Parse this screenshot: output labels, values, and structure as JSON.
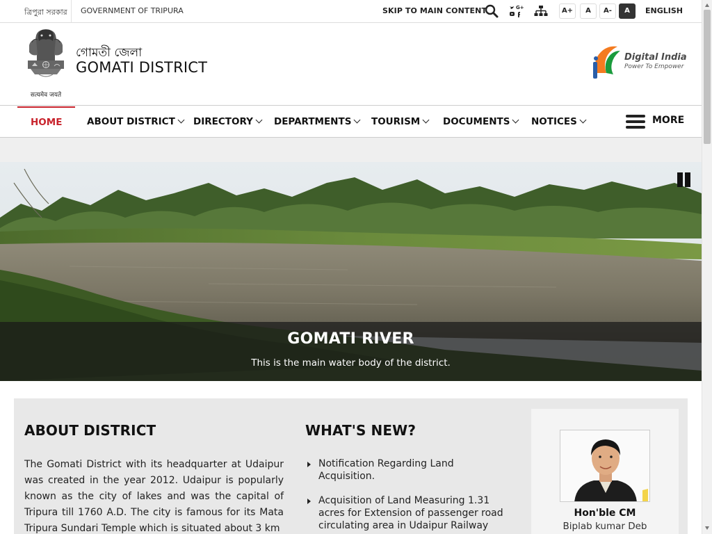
{
  "topbar": {
    "state_link": "ত্রিপুরা সরকার",
    "gov_link": "GOVERNMENT OF TRIPURA",
    "skip_link": "SKIP TO MAIN CONTENT",
    "social_mini": "G+",
    "font_increase": "A+",
    "font_normal": "A",
    "font_decrease": "A-",
    "contrast": "A",
    "language": "ENGLISH"
  },
  "header": {
    "emblem_caption": "सत्यमेव जयते",
    "site_name_local": "গোমতী জেলা",
    "site_name": "GOMATI DISTRICT",
    "partner_title": "Digital India",
    "partner_tagline": "Power To Empower"
  },
  "nav": {
    "items": [
      {
        "label": "HOME"
      },
      {
        "label": "ABOUT DISTRICT"
      },
      {
        "label": "DIRECTORY"
      },
      {
        "label": "DEPARTMENTS"
      },
      {
        "label": "TOURISM"
      },
      {
        "label": "DOCUMENTS"
      },
      {
        "label": "NOTICES"
      }
    ],
    "more_label": "MORE"
  },
  "slider": {
    "title": "GOMATI RIVER",
    "description": "This is the main water body of the district."
  },
  "about": {
    "heading": "ABOUT DISTRICT",
    "text": "The Gomati District with its headquarter at Udaipur was created in the year 2012. Udaipur is popularly known as the city of lakes and was the capital of Tripura till 1760 A.D. The city is famous for its Mata Tripura Sundari Temple which is situated about 3 km"
  },
  "whats_new": {
    "heading": "WHAT'S NEW?",
    "items": [
      "Notification Regarding Land Acquisition.",
      "Acquisition of Land Measuring 1.31 acres for Extension of passenger road circulating area in Udaipur Railway"
    ]
  },
  "cm": {
    "title": "Hon'ble CM",
    "name": "Biplab kumar Deb"
  },
  "colors": {
    "accent": "#c8232c",
    "dark": "#111111",
    "content_bg": "#e8e8e8"
  }
}
